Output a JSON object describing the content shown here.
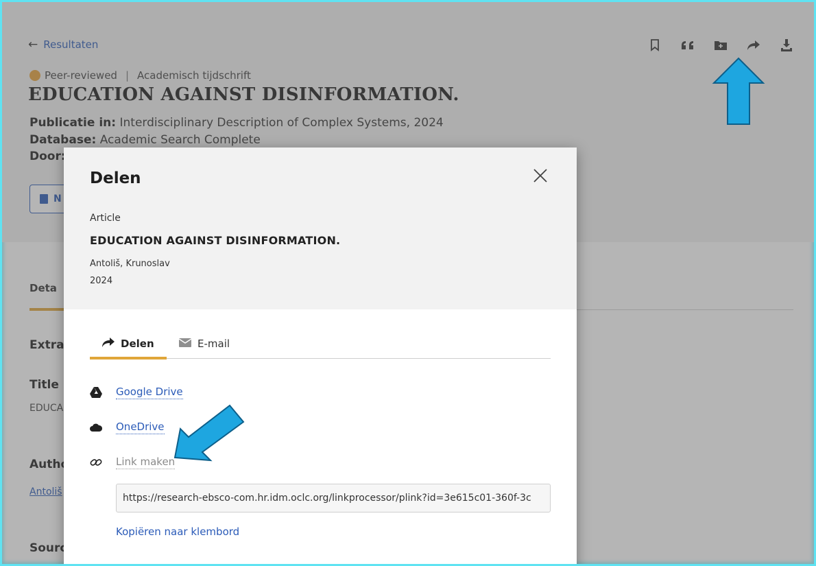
{
  "page": {
    "back_label": "Resultaten",
    "peer_reviewed": "Peer-reviewed",
    "journal_type": "Academisch tijdschrift",
    "title": "EDUCATION AGAINST DISINFORMATION.",
    "publication_label": "Publicatie in:",
    "publication_value": "Interdisciplinary Description of Complex Systems, 2024",
    "database_label": "Database:",
    "database_value": "Academic Search Complete",
    "by_label": "Door:",
    "pdf_button": "N",
    "details_tab": "Deta",
    "extra_heading": "Extra",
    "title_heading": "Title",
    "title_value": "EDUCA",
    "authors_heading": "Autho",
    "authors_value": "Antoliš",
    "source_heading": "Sourc"
  },
  "toolbar": {
    "icons": [
      "bookmark-icon",
      "quote-icon",
      "add-folder-icon",
      "share-icon",
      "download-icon"
    ]
  },
  "modal": {
    "title": "Delen",
    "type": "Article",
    "article_title": "EDUCATION AGAINST DISINFORMATION.",
    "author": "Antoliš, Krunoslav",
    "year": "2024",
    "tabs": [
      {
        "label": "Delen",
        "icon": "share-icon",
        "active": true
      },
      {
        "label": "E-mail",
        "icon": "envelope-icon",
        "active": false
      }
    ],
    "options": [
      {
        "label": "Google Drive",
        "icon": "google-drive-icon"
      },
      {
        "label": "OneDrive",
        "icon": "cloud-icon"
      },
      {
        "label": "Link maken",
        "icon": "link-icon"
      }
    ],
    "link_value": "https://research-ebsco-com.hr.idm.oclc.org/linkprocessor/plink?id=3e615c01-360f-3c",
    "copy_label": "Kopiëren naar klembord"
  },
  "colors": {
    "accent_underline": "#e0a63a",
    "link_blue": "#2b5bb8",
    "annotation_arrow": "#1ea6e0",
    "frame_border": "#5fe3f2"
  }
}
